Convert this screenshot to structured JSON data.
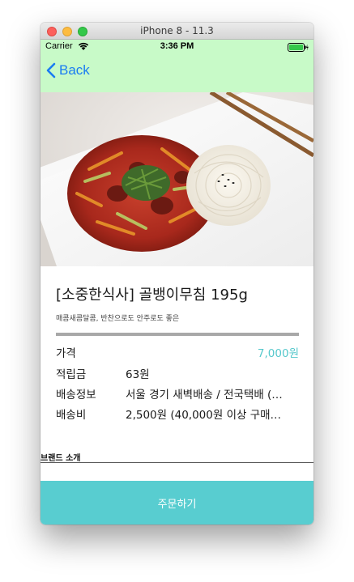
{
  "window": {
    "title": "iPhone 8 - 11.3"
  },
  "status_bar": {
    "carrier": "Carrier",
    "time": "3:36 PM"
  },
  "nav": {
    "back_label": "Back"
  },
  "product": {
    "title": "[소중한식사] 골뱅이무침 195g",
    "subtitle": "매콤새콤달콤, 반찬으로도 안주로도 좋은",
    "price_label": "가격",
    "price_value": "7,000원",
    "info": [
      {
        "label": "적립금",
        "value": "63원"
      },
      {
        "label": "배송정보",
        "value": "서울 경기 새벽배송 / 전국택배 (…"
      },
      {
        "label": "배송비",
        "value": "2,500원 (40,000원 이상 구매…"
      }
    ]
  },
  "brand": {
    "label": "브랜드 소개"
  },
  "footer": {
    "order_button": "주문하기"
  },
  "colors": {
    "nav_background": "#c8fac8",
    "accent_blue": "#1a7cf2",
    "price_teal": "#56c8cc",
    "order_button": "#58cdd0"
  }
}
